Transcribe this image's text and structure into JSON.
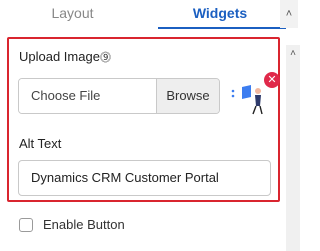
{
  "tabs": [
    {
      "label": "Layout"
    },
    {
      "label": "Widgets"
    }
  ],
  "upload": {
    "label": "Upload Image",
    "help_icon": "⓽",
    "file_placeholder": "Choose File",
    "browse_label": "Browse"
  },
  "alt_text": {
    "label": "Alt Text",
    "value": "Dynamics CRM Customer Portal"
  },
  "enable_button": {
    "label": "Enable Button",
    "checked": false
  },
  "icons": {
    "help": "help-icon",
    "delete": "delete-icon",
    "scroll_up": "chevron-up-icon",
    "preview": "image-preview-icon"
  },
  "colors": {
    "accent": "#1b5fc1",
    "highlight_border": "#d9252f",
    "delete_badge": "#e0294a"
  }
}
